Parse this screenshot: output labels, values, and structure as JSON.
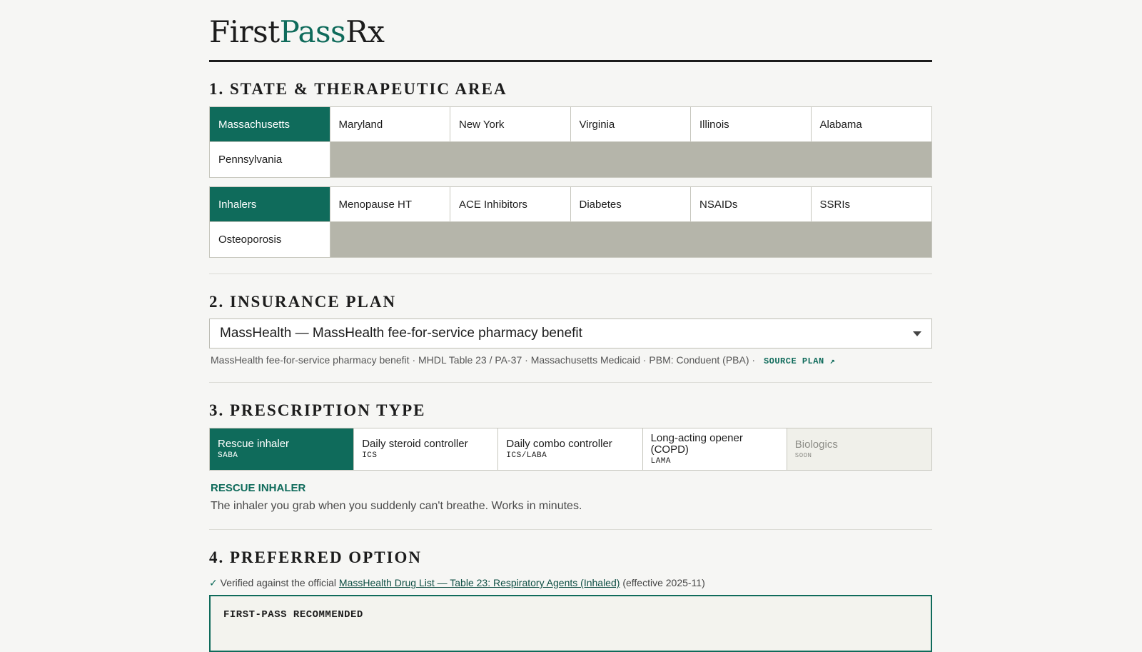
{
  "logo": {
    "part1": "First",
    "part2": "Pass",
    "part3": "Rx",
    "accent_color": "#0f6b5b"
  },
  "section1": {
    "title": "1. State & Therapeutic Area",
    "states": [
      "Massachusetts",
      "Maryland",
      "New York",
      "Virginia",
      "Illinois",
      "Alabama",
      "Pennsylvania"
    ],
    "selected_state": "Massachusetts",
    "areas": [
      "Inhalers",
      "Menopause HT",
      "ACE Inhibitors",
      "Diabetes",
      "NSAIDs",
      "SSRIs",
      "Osteoporosis"
    ],
    "selected_area": "Inhalers"
  },
  "section2": {
    "title": "2. Insurance Plan",
    "selected_plan": "MassHealth — MassHealth fee-for-service pharmacy benefit",
    "meta": "MassHealth fee-for-service pharmacy benefit · MHDL Table 23 / PA-37 · Massachusetts Medicaid · PBM: Conduent (PBA) ·",
    "source_link": "SOURCE PLAN ↗"
  },
  "section3": {
    "title": "3. Prescription Type",
    "types": [
      {
        "name": "Rescue inhaler",
        "code": "SABA"
      },
      {
        "name": "Daily steroid controller",
        "code": "ICS"
      },
      {
        "name": "Daily combo controller",
        "code": "ICS/LABA"
      },
      {
        "name": "Long-acting opener (COPD)",
        "code": "LAMA"
      },
      {
        "name": "Biologics",
        "code": "SOON"
      }
    ],
    "selected_index": 0,
    "disabled_index": 4,
    "detail_heading": "Rescue inhaler",
    "detail_text": "The inhaler you grab when you suddenly can't breathe. Works in minutes."
  },
  "section4": {
    "title": "4. Preferred Option",
    "verified_prefix": "Verified against the official",
    "verified_link": "MassHealth Drug List — Table 23: Respiratory Agents (Inhaled)",
    "verified_suffix": "(effective 2025-11)",
    "reco_label": "FIRST-PASS RECOMMENDED"
  }
}
